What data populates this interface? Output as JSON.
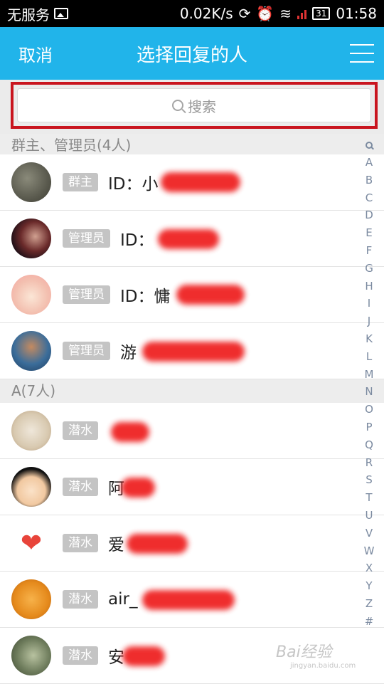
{
  "status_bar": {
    "carrier": "无服务",
    "speed": "0.02K/s",
    "battery": "31",
    "time": "01:58"
  },
  "header": {
    "cancel_label": "取消",
    "title": "选择回复的人"
  },
  "search": {
    "placeholder": "搜索"
  },
  "sections": [
    {
      "title": "群主、管理员(4人)",
      "members": [
        {
          "badge": "群主",
          "name": "ID：小"
        },
        {
          "badge": "管理员",
          "name": "ID："
        },
        {
          "badge": "管理员",
          "name": "ID：慵"
        },
        {
          "badge": "管理员",
          "name": "游"
        }
      ]
    },
    {
      "title": "A(7人)",
      "members": [
        {
          "badge": "潜水",
          "name": ""
        },
        {
          "badge": "潜水",
          "name": "阿"
        },
        {
          "badge": "潜水",
          "name": "爱"
        },
        {
          "badge": "潜水",
          "name": "air_"
        },
        {
          "badge": "潜水",
          "name": "安"
        }
      ]
    }
  ],
  "index_letters": [
    "A",
    "B",
    "C",
    "D",
    "E",
    "F",
    "G",
    "H",
    "I",
    "J",
    "K",
    "L",
    "M",
    "N",
    "O",
    "P",
    "Q",
    "R",
    "S",
    "T",
    "U",
    "V",
    "W",
    "X",
    "Y",
    "Z",
    "#"
  ],
  "watermark": {
    "brand": "Bai经验",
    "url": "jingyan.baidu.com"
  },
  "colors": {
    "topbar": "#21b4ea",
    "highlight": "#c9151f",
    "badge": "#c4c4c4"
  }
}
